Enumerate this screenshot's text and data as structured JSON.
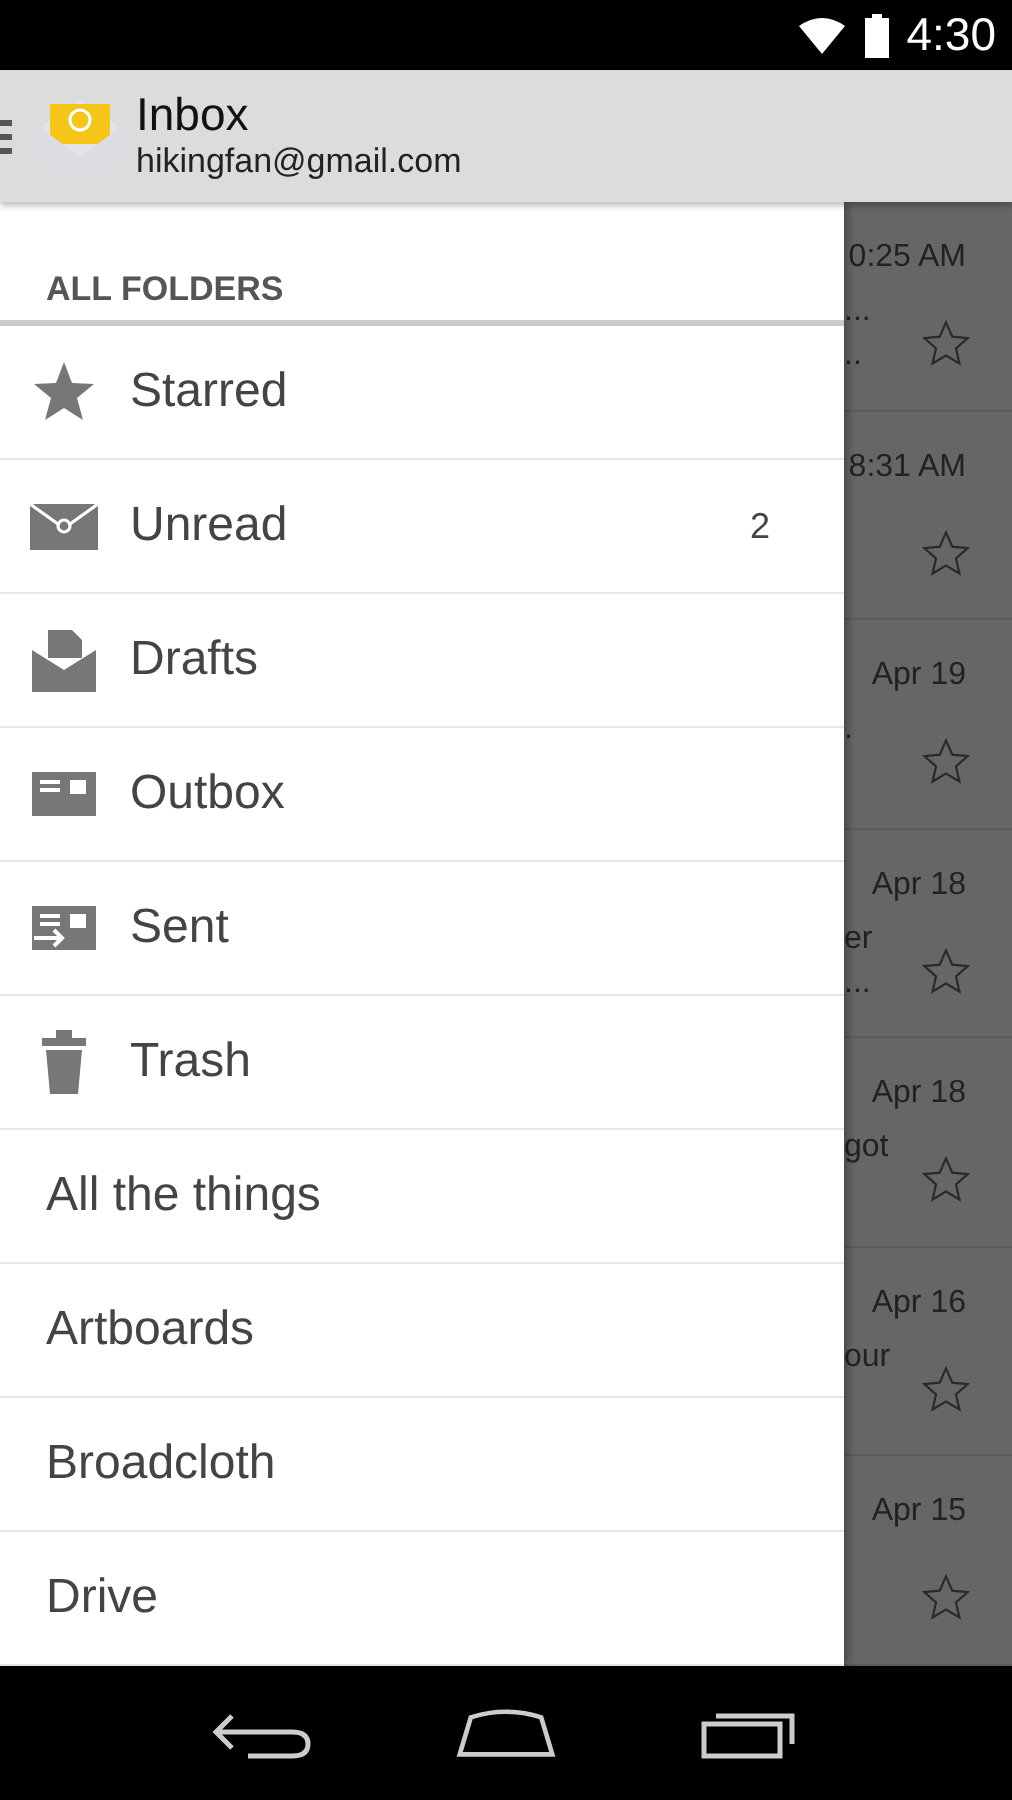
{
  "status_bar": {
    "time": "4:30"
  },
  "action_bar": {
    "title": "Inbox",
    "account": "hikingfan@gmail.com"
  },
  "drawer": {
    "header": "ALL FOLDERS",
    "folders": [
      {
        "label": "Starred",
        "kind": "system"
      },
      {
        "label": "Unread",
        "kind": "system",
        "count": "2"
      },
      {
        "label": "Drafts",
        "kind": "system"
      },
      {
        "label": "Outbox",
        "kind": "system"
      },
      {
        "label": "Sent",
        "kind": "system"
      },
      {
        "label": "Trash",
        "kind": "system"
      },
      {
        "label": "All the things",
        "kind": "label"
      },
      {
        "label": "Artboards",
        "kind": "label"
      },
      {
        "label": "Broadcloth",
        "kind": "label"
      },
      {
        "label": "Drive",
        "kind": "label"
      }
    ]
  },
  "messages": [
    {
      "date": "0:25 AM",
      "snippets": [
        "...",
        ".."
      ],
      "starred": false
    },
    {
      "date": "8:31 AM",
      "starred": false
    },
    {
      "date": "Apr 19",
      "snippets": [
        "."
      ],
      "starred": false
    },
    {
      "date": "Apr 18",
      "snippets": [
        "er",
        "..."
      ],
      "starred": false
    },
    {
      "date": "Apr 18",
      "snippets": [
        "got"
      ],
      "starred": false
    },
    {
      "date": "Apr 16",
      "snippets": [
        "our"
      ],
      "starred": false
    },
    {
      "date": "Apr 15",
      "starred": false
    }
  ]
}
